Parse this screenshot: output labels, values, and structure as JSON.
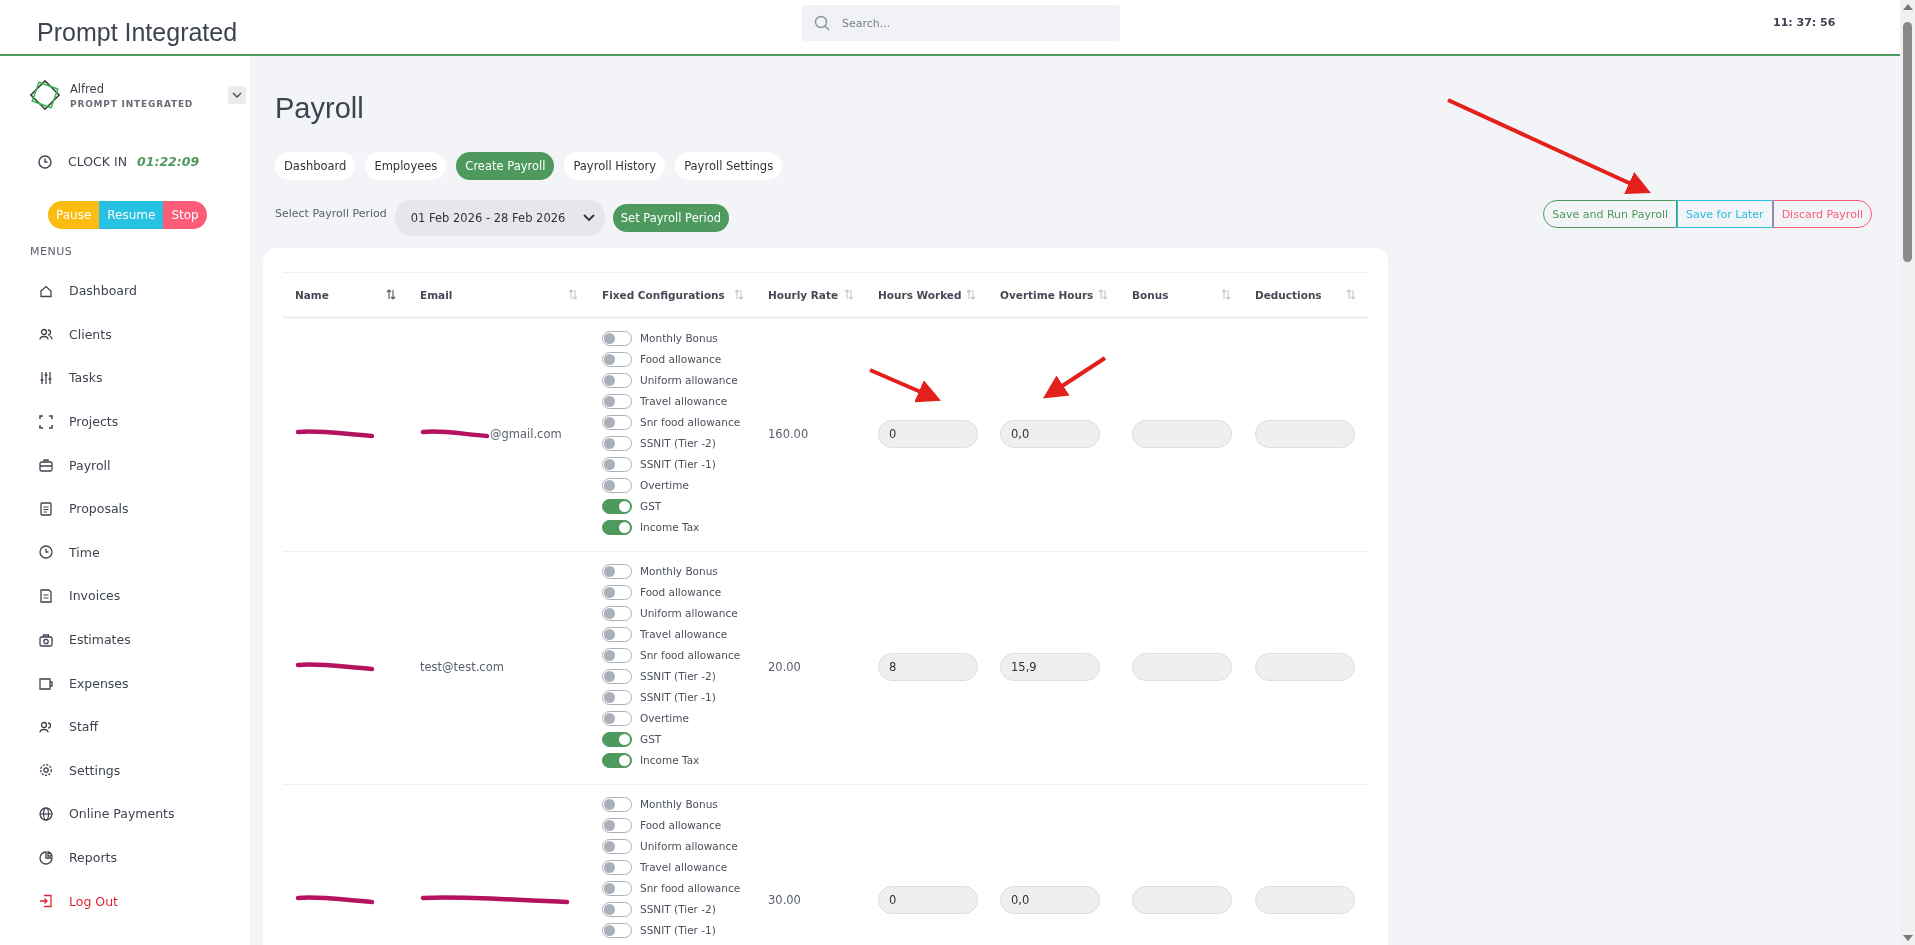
{
  "header": {
    "title": "Prompt Integrated",
    "search": {
      "placeholder": "Search..."
    },
    "time": "11: 37: 56"
  },
  "sidebar": {
    "user": {
      "name": "Alfred",
      "company": "PROMPT INTEGRATED"
    },
    "clock": {
      "label": "CLOCK IN",
      "elapsed": "01:22:09"
    },
    "timer_buttons": [
      {
        "label": "Pause",
        "color": "#fbbc12"
      },
      {
        "label": "Resume",
        "color": "#27c1e3"
      },
      {
        "label": "Stop",
        "color": "#fc5c78"
      }
    ],
    "section": "MENUS",
    "items": [
      {
        "label": "Dashboard",
        "kind": "normal"
      },
      {
        "label": "Clients",
        "kind": "normal"
      },
      {
        "label": "Tasks",
        "kind": "normal"
      },
      {
        "label": "Projects",
        "kind": "normal"
      },
      {
        "label": "Payroll",
        "kind": "normal"
      },
      {
        "label": "Proposals",
        "kind": "normal"
      },
      {
        "label": "Time",
        "kind": "normal"
      },
      {
        "label": "Invoices",
        "kind": "normal"
      },
      {
        "label": "Estimates",
        "kind": "normal"
      },
      {
        "label": "Expenses",
        "kind": "normal"
      },
      {
        "label": "Staff",
        "kind": "normal"
      },
      {
        "label": "Settings",
        "kind": "normal"
      },
      {
        "label": "Online Payments",
        "kind": "normal"
      },
      {
        "label": "Reports",
        "kind": "normal"
      },
      {
        "label": "Log Out",
        "kind": "danger"
      }
    ]
  },
  "page": {
    "title": "Payroll",
    "tabs": [
      {
        "label": "Dashboard",
        "selected": false
      },
      {
        "label": "Employees",
        "selected": false
      },
      {
        "label": "Create Payroll",
        "selected": true
      },
      {
        "label": "Payroll History",
        "selected": false
      },
      {
        "label": "Payroll Settings",
        "selected": false
      }
    ],
    "period": {
      "label": "Select Payroll Period",
      "value": "01 Feb 2026 - 28 Feb 2026",
      "button": "Set Payroll Period"
    },
    "actions": [
      {
        "label": "Save and Run Payroll",
        "color": "#4e9a5e"
      },
      {
        "label": "Save for Later",
        "color": "#27c1e3"
      },
      {
        "label": "Discard Payroll",
        "color": "#fc5c78"
      }
    ]
  },
  "table": {
    "columns": [
      {
        "label": "Name",
        "sorted": true
      },
      {
        "label": "Email",
        "sorted": false
      },
      {
        "label": "Fixed Configurations",
        "sorted": false
      },
      {
        "label": "Hourly Rate",
        "sorted": false
      },
      {
        "label": "Hours Worked",
        "sorted": false
      },
      {
        "label": "Overtime Hours",
        "sorted": false
      },
      {
        "label": "Bonus",
        "sorted": false
      },
      {
        "label": "Deductions",
        "sorted": false
      }
    ],
    "rows": [
      {
        "name_redacted": true,
        "email": "@gmail.com",
        "email_redacted": true,
        "rate": "160.00",
        "hours": "0",
        "overtime": "0,0",
        "configs": [
          {
            "label": "Monthly Bonus",
            "on": false
          },
          {
            "label": "Food allowance",
            "on": false
          },
          {
            "label": "Uniform allowance",
            "on": false
          },
          {
            "label": "Travel allowance",
            "on": false
          },
          {
            "label": "Snr food allowance",
            "on": false
          },
          {
            "label": "SSNIT (Tier -2)",
            "on": false
          },
          {
            "label": "SSNIT (Tier -1)",
            "on": false
          },
          {
            "label": "Overtime",
            "on": false
          },
          {
            "label": "GST",
            "on": true
          },
          {
            "label": "Income Tax",
            "on": true
          }
        ]
      },
      {
        "name_redacted": true,
        "email": "test@test.com",
        "rate": "20.00",
        "hours": "8",
        "overtime": "15,9",
        "configs": [
          {
            "label": "Monthly Bonus",
            "on": false
          },
          {
            "label": "Food allowance",
            "on": false
          },
          {
            "label": "Uniform allowance",
            "on": false
          },
          {
            "label": "Travel allowance",
            "on": false
          },
          {
            "label": "Snr food allowance",
            "on": false
          },
          {
            "label": "SSNIT (Tier -2)",
            "on": false
          },
          {
            "label": "SSNIT (Tier -1)",
            "on": false
          },
          {
            "label": "Overtime",
            "on": false
          },
          {
            "label": "GST",
            "on": true
          },
          {
            "label": "Income Tax",
            "on": true
          }
        ]
      },
      {
        "name_redacted": true,
        "email_redacted": true,
        "rate": "30.00",
        "hours": "0",
        "overtime": "0,0",
        "configs": [
          {
            "label": "Monthly Bonus",
            "on": false
          },
          {
            "label": "Food allowance",
            "on": false
          },
          {
            "label": "Uniform allowance",
            "on": false
          },
          {
            "label": "Travel allowance",
            "on": false
          },
          {
            "label": "Snr food allowance",
            "on": false
          },
          {
            "label": "SSNIT (Tier -2)",
            "on": false
          },
          {
            "label": "SSNIT (Tier -1)",
            "on": false
          }
        ]
      }
    ]
  }
}
